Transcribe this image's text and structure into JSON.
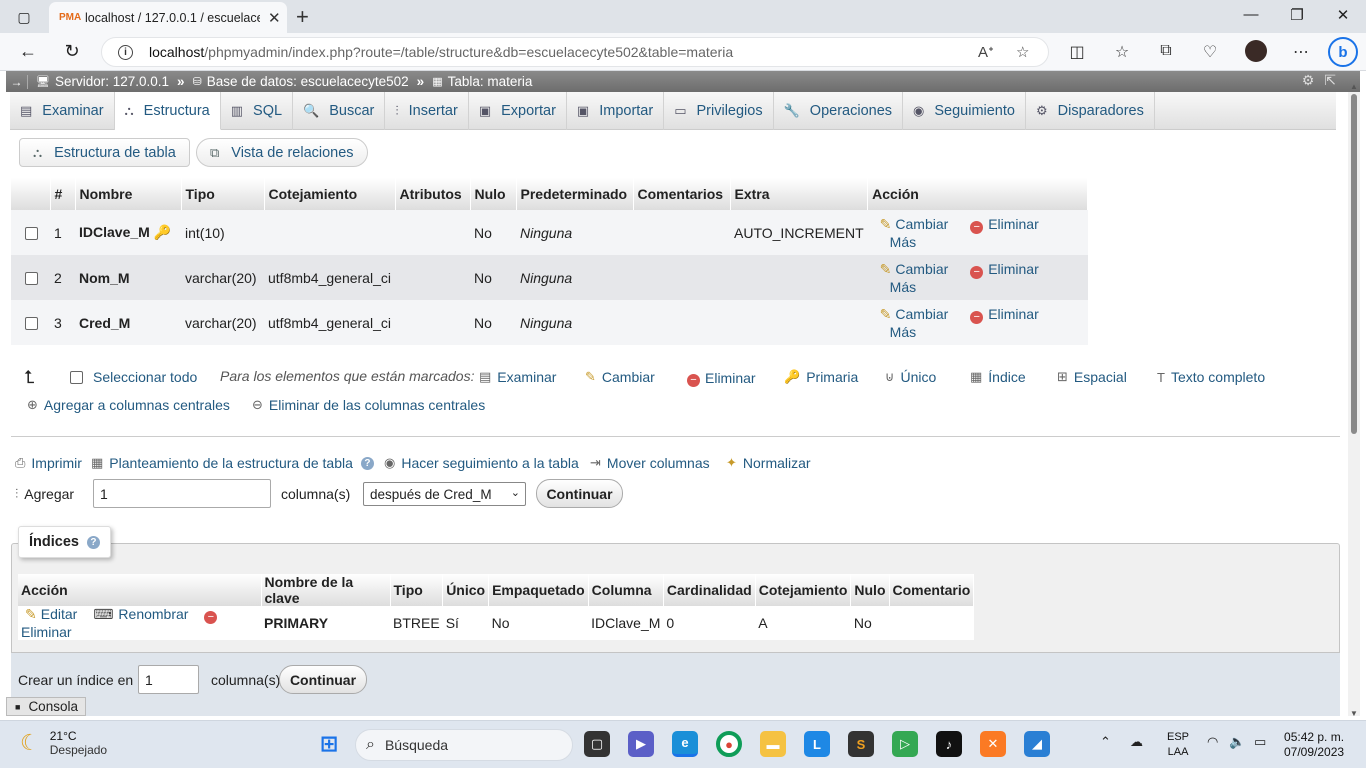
{
  "browser": {
    "tab_title": "localhost / 127.0.0.1 / escuelacec",
    "url_host": "localhost",
    "url_path": "/phpmyadmin/index.php?route=/table/structure&db=escuelacecyte502&table=materia"
  },
  "breadcrumb": {
    "server": "Servidor: 127.0.0.1",
    "database": "Base de datos: escuelacecyte502",
    "table": "Tabla: materia"
  },
  "tabs": [
    {
      "label": "Examinar",
      "icon": "browse-icon"
    },
    {
      "label": "Estructura",
      "icon": "structure-icon"
    },
    {
      "label": "SQL",
      "icon": "sql-icon"
    },
    {
      "label": "Buscar",
      "icon": "search-icon"
    },
    {
      "label": "Insertar",
      "icon": "insert-icon"
    },
    {
      "label": "Exportar",
      "icon": "export-icon"
    },
    {
      "label": "Importar",
      "icon": "import-icon"
    },
    {
      "label": "Privilegios",
      "icon": "privileges-icon"
    },
    {
      "label": "Operaciones",
      "icon": "wrench-icon"
    },
    {
      "label": "Seguimiento",
      "icon": "eye-icon"
    },
    {
      "label": "Disparadores",
      "icon": "triggers-icon"
    }
  ],
  "subnav": {
    "structure": "Estructura de tabla",
    "relations": "Vista de relaciones"
  },
  "structure": {
    "headers": [
      "#",
      "Nombre",
      "Tipo",
      "Cotejamiento",
      "Atributos",
      "Nulo",
      "Predeterminado",
      "Comentarios",
      "Extra",
      "Acción"
    ],
    "rows": [
      {
        "num": "1",
        "name": "IDClave_M",
        "type": "int(10)",
        "collation": "",
        "attributes": "",
        "null": "No",
        "default": "Ninguna",
        "comments": "",
        "extra": "AUTO_INCREMENT"
      },
      {
        "num": "2",
        "name": "Nom_M",
        "type": "varchar(20)",
        "collation": "utf8mb4_general_ci",
        "attributes": "",
        "null": "No",
        "default": "Ninguna",
        "comments": "",
        "extra": ""
      },
      {
        "num": "3",
        "name": "Cred_M",
        "type": "varchar(20)",
        "collation": "utf8mb4_general_ci",
        "attributes": "",
        "null": "No",
        "default": "Ninguna",
        "comments": "",
        "extra": ""
      }
    ],
    "actions": {
      "change": "Cambiar",
      "drop": "Eliminar",
      "more": "Más"
    }
  },
  "bulk": {
    "select_all": "Seleccionar todo",
    "with_selected": "Para los elementos que están marcados:",
    "browse": "Examinar",
    "change": "Cambiar",
    "drop": "Eliminar",
    "primary": "Primaria",
    "unique": "Único",
    "index": "Índice",
    "spatial": "Espacial",
    "fulltext": "Texto completo",
    "add_central": "Agregar a columnas centrales",
    "remove_central": "Eliminar de las columnas centrales"
  },
  "tools": {
    "print": "Imprimir",
    "propose": "Planteamiento de la estructura de tabla",
    "track": "Hacer seguimiento a la tabla",
    "move": "Mover columnas",
    "normalize": "Normalizar"
  },
  "add_columns": {
    "label": "Agregar",
    "count": "1",
    "unit": "columna(s)",
    "position": "después de Cred_M",
    "submit": "Continuar"
  },
  "indexes": {
    "legend": "Índices",
    "headers": [
      "Acción",
      "Nombre de la clave",
      "Tipo",
      "Único",
      "Empaquetado",
      "Columna",
      "Cardinalidad",
      "Cotejamiento",
      "Nulo",
      "Comentario"
    ],
    "actions": {
      "edit": "Editar",
      "rename": "Renombrar",
      "drop": "Eliminar"
    },
    "row": {
      "key": "PRIMARY",
      "type": "BTREE",
      "unique": "Sí",
      "packed": "No",
      "column": "IDClave_M",
      "cardinality": "0",
      "collation": "A",
      "null": "No",
      "comment": ""
    },
    "create_label": "Crear un índice en",
    "create_count": "1",
    "create_unit": "columna(s)",
    "create_submit": "Continuar"
  },
  "console": "Consola",
  "taskbar": {
    "temp": "21°C",
    "weather": "Despejado",
    "search": "Búsqueda",
    "lang1": "ESP",
    "lang2": "LAA",
    "time": "05:42 p. m.",
    "date": "07/09/2023"
  }
}
